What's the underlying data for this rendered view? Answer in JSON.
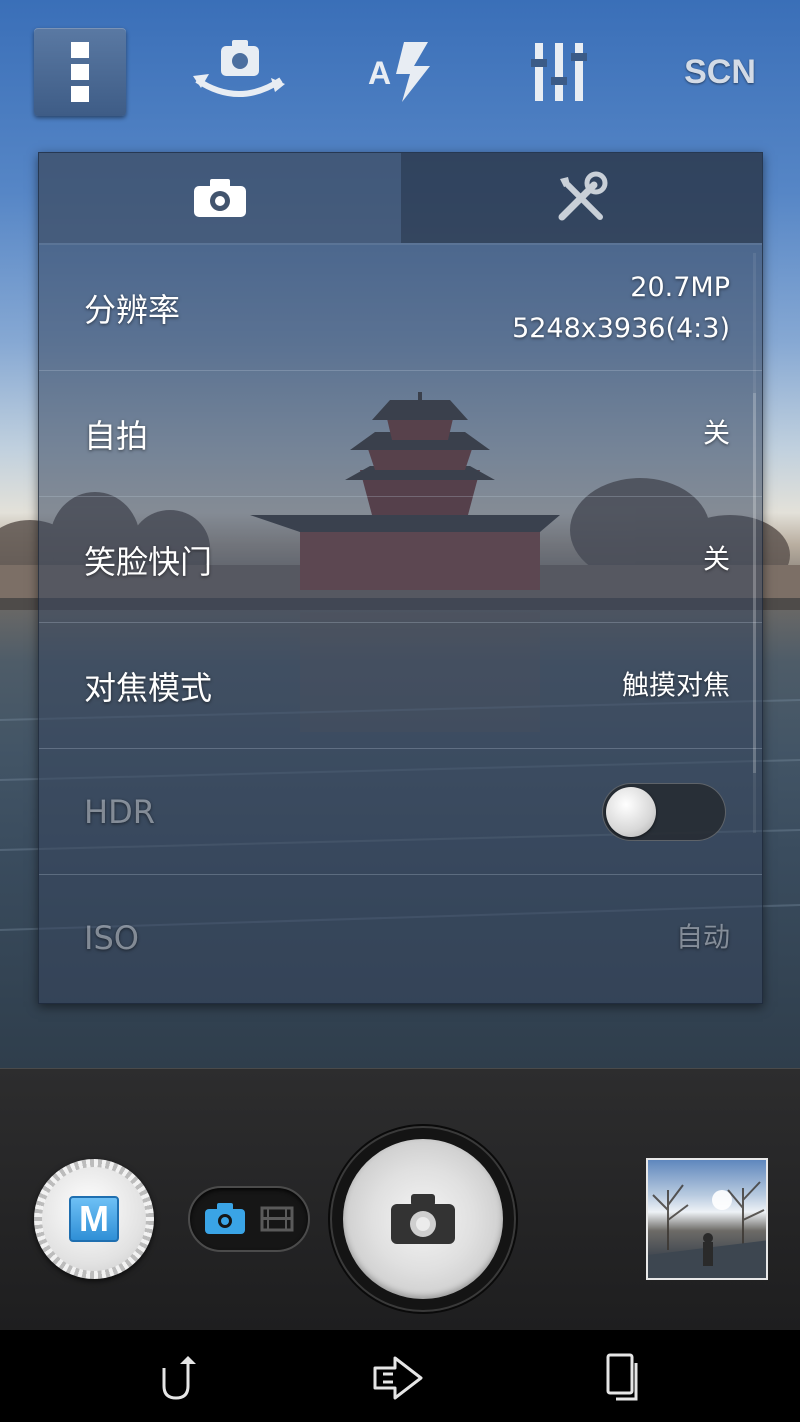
{
  "toolbar": {
    "menu_icon": "vertical-dots-icon",
    "switch_camera_icon": "switch-camera-icon",
    "flash_icon": "flash-auto-icon",
    "adjust_icon": "sliders-icon",
    "scene_label": "SCN"
  },
  "settings_panel": {
    "tabs": [
      {
        "icon": "camera-icon",
        "active": true
      },
      {
        "icon": "tools-icon",
        "active": false
      }
    ],
    "rows": [
      {
        "label": "分辨率",
        "value_line1": "20.7MP",
        "value_line2": "5248x3936(4:3)"
      },
      {
        "label": "自拍",
        "value": "关"
      },
      {
        "label": "笑脸快门",
        "value": "关"
      },
      {
        "label": "对焦模式",
        "value": "触摸对焦"
      },
      {
        "label": "HDR",
        "toggle": false
      },
      {
        "label": "ISO",
        "value": "自动"
      }
    ]
  },
  "controls": {
    "mode_dial_label": "M",
    "mode_switch": {
      "selected": "photo",
      "options": [
        "photo",
        "video"
      ]
    },
    "shutter_icon": "camera-icon",
    "last_photo_icon": "thumbnail"
  },
  "navbar": {
    "back_icon": "back-icon",
    "home_icon": "home-icon",
    "recents_icon": "recents-icon"
  },
  "colors": {
    "accent_blue": "#2f8fd6",
    "panel_bg": "#36465c"
  }
}
